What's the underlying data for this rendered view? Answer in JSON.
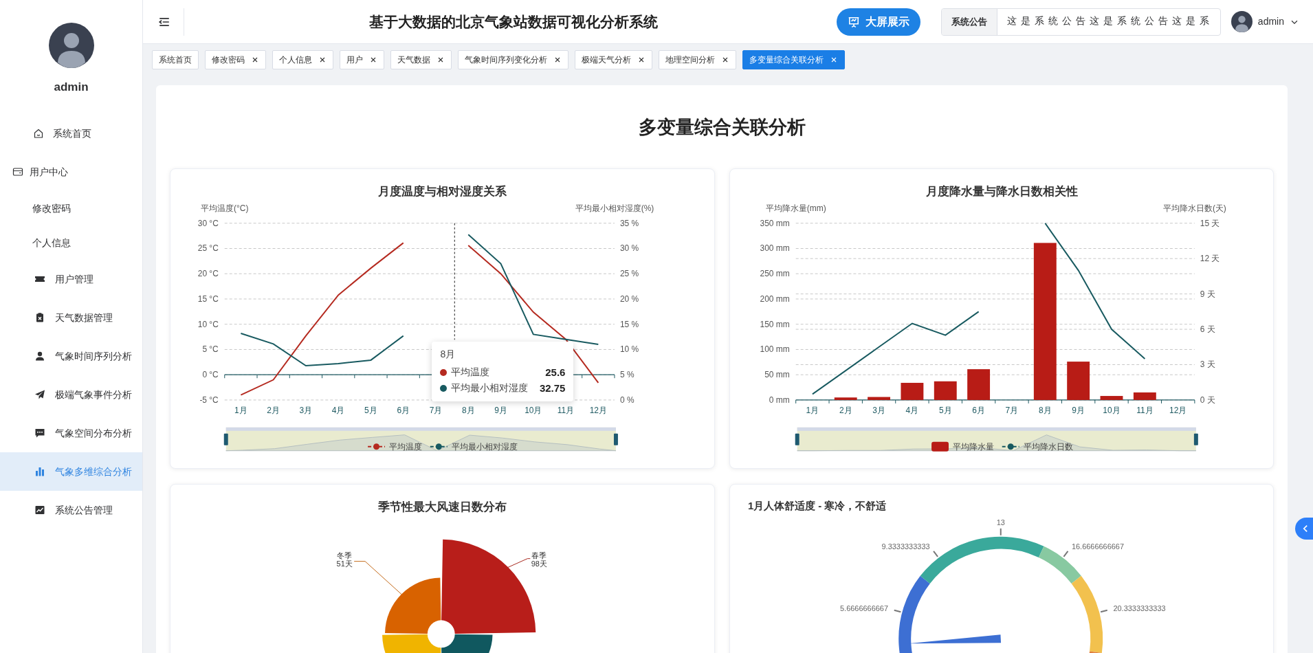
{
  "sidebar": {
    "user": {
      "name": "admin"
    },
    "items": [
      {
        "kind": "link",
        "label": "系统首页",
        "selected": false
      },
      {
        "kind": "group",
        "label": "用户中心",
        "children": [
          {
            "label": "修改密码",
            "selected": false
          },
          {
            "label": "个人信息",
            "selected": false
          }
        ]
      },
      {
        "kind": "link",
        "label": "用户管理",
        "selected": false
      },
      {
        "kind": "link",
        "label": "天气数据管理",
        "selected": false
      },
      {
        "kind": "link",
        "label": "气象时间序列分析",
        "selected": false
      },
      {
        "kind": "link",
        "label": "极端气象事件分析",
        "selected": false
      },
      {
        "kind": "link",
        "label": "气象空间分布分析",
        "selected": false
      },
      {
        "kind": "link",
        "label": "气象多维综合分析",
        "selected": true
      },
      {
        "kind": "link",
        "label": "系统公告管理",
        "selected": false
      }
    ]
  },
  "header": {
    "title": "基于大数据的北京气象站数据可视化分析系统",
    "screen_button": "大屏展示",
    "notice": {
      "label": "系统公告",
      "text": "这是系统公告这是系统公告这是系"
    },
    "user": {
      "name": "admin"
    }
  },
  "tabs": [
    {
      "label": "系统首页",
      "closable": false,
      "selected": false
    },
    {
      "label": "修改密码",
      "closable": true,
      "selected": false
    },
    {
      "label": "个人信息",
      "closable": true,
      "selected": false
    },
    {
      "label": "用户",
      "closable": true,
      "selected": false
    },
    {
      "label": "天气数据",
      "closable": true,
      "selected": false
    },
    {
      "label": "气象时间序列变化分析",
      "closable": true,
      "selected": false
    },
    {
      "label": "极端天气分析",
      "closable": true,
      "selected": false
    },
    {
      "label": "地理空间分析",
      "closable": true,
      "selected": false
    },
    {
      "label": "多变量综合关联分析",
      "closable": true,
      "selected": true
    }
  ],
  "page": {
    "title": "多变量综合关联分析",
    "charts": [
      {
        "kind": "dual_axis",
        "chart_data": {
          "type": "line",
          "grid": true,
          "legend": "bottom",
          "title": "月度温度与相对湿度关系",
          "ylabel": "平均温度(°C)",
          "y2label": "平均最小相对湿度(%)",
          "categories": [
            "1月",
            "2月",
            "3月",
            "4月",
            "5月",
            "6月",
            "7月",
            "8月",
            "9月",
            "10月",
            "11月",
            "12月"
          ],
          "ylim": [
            -5,
            30
          ],
          "yticks": [
            {
              "value": -5,
              "label": "-5 °C"
            },
            {
              "value": 0,
              "label": "0 °C"
            },
            {
              "value": 5,
              "label": "5 °C"
            },
            {
              "value": 10,
              "label": "10 °C"
            },
            {
              "value": 15,
              "label": "15 °C"
            },
            {
              "value": 20,
              "label": "20 °C"
            },
            {
              "value": 25,
              "label": "25 °C"
            },
            {
              "value": 30,
              "label": "30 °C"
            }
          ],
          "y2lim": [
            0,
            35
          ],
          "y2ticks": [
            {
              "value": 0,
              "label": "0 %"
            },
            {
              "value": 5,
              "label": "5 %"
            },
            {
              "value": 10,
              "label": "10 %"
            },
            {
              "value": 15,
              "label": "15 %"
            },
            {
              "value": 20,
              "label": "20 %"
            },
            {
              "value": 25,
              "label": "25 %"
            },
            {
              "value": 30,
              "label": "30 %"
            },
            {
              "value": 35,
              "label": "35 %"
            }
          ],
          "series": [
            {
              "name": "平均温度",
              "axis": "y",
              "color": "#b52a20",
              "values": [
                -4,
                -1,
                7.7,
                15.8,
                21.1,
                26.1,
                null,
                25.6,
                20,
                12.4,
                7,
                -1.6
              ]
            },
            {
              "name": "平均最小相对湿度",
              "axis": "y2",
              "color": "#185a60",
              "values": [
                13.2,
                11.1,
                6.8,
                7.2,
                7.9,
                12.7,
                null,
                32.75,
                27,
                13,
                12,
                11
              ]
            }
          ]
        },
        "tooltip": {
          "title": "8月",
          "rows": [
            {
              "name": "平均温度",
              "value": "25.6",
              "color": "#b52a20"
            },
            {
              "name": "平均最小相对湿度",
              "value": "32.75",
              "color": "#185a60"
            }
          ]
        }
      },
      {
        "kind": "dual_axis",
        "chart_data": {
          "type": "bar",
          "grid": true,
          "legend": "bottom",
          "title": "月度降水量与降水日数相关性",
          "ylabel": "平均降水量(mm)",
          "y2label": "平均降水日数(天)",
          "categories": [
            "1月",
            "2月",
            "3月",
            "4月",
            "5月",
            "6月",
            "7月",
            "8月",
            "9月",
            "10月",
            "11月",
            "12月"
          ],
          "ylim": [
            0,
            350
          ],
          "yticks": [
            {
              "value": 0,
              "label": "0 mm"
            },
            {
              "value": 50,
              "label": "50 mm"
            },
            {
              "value": 100,
              "label": "100 mm"
            },
            {
              "value": 150,
              "label": "150 mm"
            },
            {
              "value": 200,
              "label": "200 mm"
            },
            {
              "value": 250,
              "label": "250 mm"
            },
            {
              "value": 300,
              "label": "300 mm"
            },
            {
              "value": 350,
              "label": "350 mm"
            }
          ],
          "y2lim": [
            0,
            15
          ],
          "y2ticks": [
            {
              "value": 0,
              "label": "0 天"
            },
            {
              "value": 3,
              "label": "3 天"
            },
            {
              "value": 6,
              "label": "6 天"
            },
            {
              "value": 9,
              "label": "9 天"
            },
            {
              "value": 12,
              "label": "12 天"
            },
            {
              "value": 15,
              "label": "15 天"
            }
          ],
          "series": [
            {
              "name": "平均降水量",
              "axis": "y",
              "color": "#b81c16",
              "values": [
                null,
                5,
                6,
                34,
                37,
                61,
                null,
                311,
                76,
                8,
                15,
                null
              ]
            },
            {
              "name": "平均降水日数",
              "type": "line",
              "axis": "y2",
              "color": "#185a60",
              "values": [
                0.5,
                2.5,
                4.5,
                6.5,
                5.5,
                7.5,
                null,
                15,
                11,
                6,
                3.5,
                null
              ]
            }
          ]
        }
      },
      {
        "kind": "rose",
        "title": "季节性最大风速日数分布",
        "labels": [
          {
            "name": "冬季",
            "value": "51天"
          },
          {
            "name": "春季",
            "value": "98天"
          }
        ]
      },
      {
        "kind": "gauge",
        "title": "1月人体舒适度 - 寒冷，不舒适",
        "scale_labels": [
          "5.6666666667",
          "9.3333333333",
          "13",
          "16.6666666667",
          "20.3333333333"
        ]
      }
    ]
  }
}
